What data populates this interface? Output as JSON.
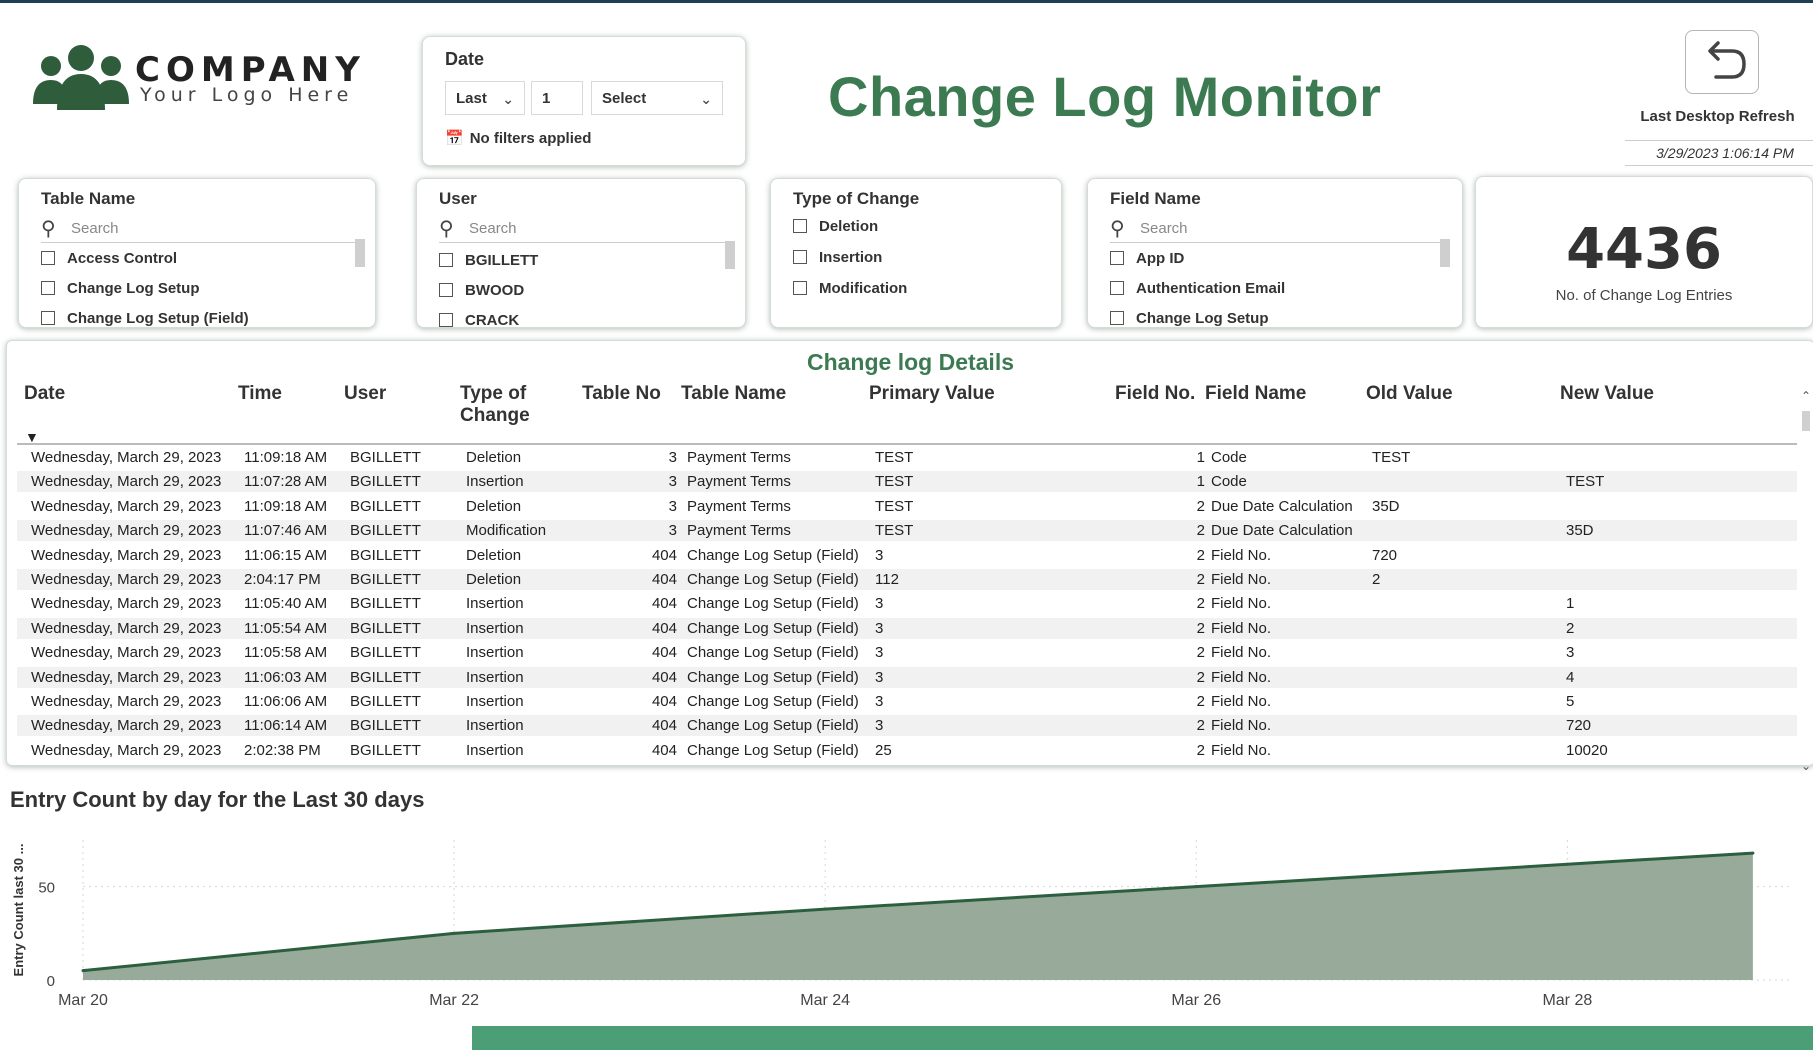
{
  "logo": {
    "company": "COMPANY",
    "tagline": "Your Logo Here"
  },
  "date_filter": {
    "label": "Date",
    "period_option": "Last",
    "period_count": "1",
    "unit_placeholder": "Select",
    "status": "No filters applied"
  },
  "header": {
    "title": "Change Log Monitor"
  },
  "refresh": {
    "label": "Last Desktop Refresh",
    "timestamp": "3/29/2023 1:06:14 PM"
  },
  "slicers": {
    "table_name": {
      "title": "Table Name",
      "search_placeholder": "Search",
      "options": [
        "Access Control",
        "Change Log Setup",
        "Change Log Setup (Field)"
      ]
    },
    "user": {
      "title": "User",
      "search_placeholder": "Search",
      "options": [
        "BGILLETT",
        "BWOOD",
        "CRACK"
      ]
    },
    "type_of_change": {
      "title": "Type of Change",
      "options": [
        "Deletion",
        "Insertion",
        "Modification"
      ]
    },
    "field_name": {
      "title": "Field Name",
      "search_placeholder": "Search",
      "options": [
        "App ID",
        "Authentication Email",
        "Change Log Setup"
      ]
    }
  },
  "kpi": {
    "value": "4436",
    "label": "No. of Change Log Entries"
  },
  "details_table": {
    "title": "Change log Details",
    "columns": {
      "date": "Date",
      "time": "Time",
      "user": "User",
      "type_of_change_1": "Type of",
      "type_of_change_2": "Change",
      "table_no": "Table No",
      "table_name": "Table Name",
      "primary_value": "Primary Value",
      "field_no": "Field No.",
      "field_name": "Field Name",
      "old_value": "Old Value",
      "new_value": "New Value"
    },
    "rows": [
      [
        "Wednesday, March 29, 2023",
        "11:09:18 AM",
        "BGILLETT",
        "Deletion",
        "3",
        "Payment Terms",
        "TEST",
        "1",
        "Code",
        "TEST",
        ""
      ],
      [
        "Wednesday, March 29, 2023",
        "11:07:28 AM",
        "BGILLETT",
        "Insertion",
        "3",
        "Payment Terms",
        "TEST",
        "1",
        "Code",
        "",
        "TEST"
      ],
      [
        "Wednesday, March 29, 2023",
        "11:09:18 AM",
        "BGILLETT",
        "Deletion",
        "3",
        "Payment Terms",
        "TEST",
        "2",
        "Due Date Calculation",
        "35D",
        ""
      ],
      [
        "Wednesday, March 29, 2023",
        "11:07:46 AM",
        "BGILLETT",
        "Modification",
        "3",
        "Payment Terms",
        "TEST",
        "2",
        "Due Date Calculation",
        "",
        "35D"
      ],
      [
        "Wednesday, March 29, 2023",
        "11:06:15 AM",
        "BGILLETT",
        "Deletion",
        "404",
        "Change Log Setup (Field)",
        "3",
        "2",
        "Field No.",
        "720",
        ""
      ],
      [
        "Wednesday, March 29, 2023",
        "2:04:17 PM",
        "BGILLETT",
        "Deletion",
        "404",
        "Change Log Setup (Field)",
        "112",
        "2",
        "Field No.",
        "2",
        ""
      ],
      [
        "Wednesday, March 29, 2023",
        "11:05:40 AM",
        "BGILLETT",
        "Insertion",
        "404",
        "Change Log Setup (Field)",
        "3",
        "2",
        "Field No.",
        "",
        "1"
      ],
      [
        "Wednesday, March 29, 2023",
        "11:05:54 AM",
        "BGILLETT",
        "Insertion",
        "404",
        "Change Log Setup (Field)",
        "3",
        "2",
        "Field No.",
        "",
        "2"
      ],
      [
        "Wednesday, March 29, 2023",
        "11:05:58 AM",
        "BGILLETT",
        "Insertion",
        "404",
        "Change Log Setup (Field)",
        "3",
        "2",
        "Field No.",
        "",
        "3"
      ],
      [
        "Wednesday, March 29, 2023",
        "11:06:03 AM",
        "BGILLETT",
        "Insertion",
        "404",
        "Change Log Setup (Field)",
        "3",
        "2",
        "Field No.",
        "",
        "4"
      ],
      [
        "Wednesday, March 29, 2023",
        "11:06:06 AM",
        "BGILLETT",
        "Insertion",
        "404",
        "Change Log Setup (Field)",
        "3",
        "2",
        "Field No.",
        "",
        "5"
      ],
      [
        "Wednesday, March 29, 2023",
        "11:06:14 AM",
        "BGILLETT",
        "Insertion",
        "404",
        "Change Log Setup (Field)",
        "3",
        "2",
        "Field No.",
        "",
        "720"
      ],
      [
        "Wednesday, March 29, 2023",
        "2:02:38 PM",
        "BGILLETT",
        "Insertion",
        "404",
        "Change Log Setup (Field)",
        "25",
        "2",
        "Field No.",
        "",
        "10020"
      ]
    ]
  },
  "chart_data": {
    "type": "area",
    "title": "Entry Count by day for the Last 30 days",
    "ylabel": "Entry Count last 30 ...",
    "xlabel": "",
    "x": [
      "Mar 20",
      "Mar 22",
      "Mar 24",
      "Mar 26",
      "Mar 28",
      "Mar 29"
    ],
    "x_ticks": [
      "Mar 20",
      "Mar 22",
      "Mar 24",
      "Mar 26",
      "Mar 28"
    ],
    "values": [
      5,
      25,
      38,
      50,
      62,
      68
    ],
    "y_ticks": [
      0,
      50
    ],
    "ylim": [
      0,
      75
    ],
    "grid": true,
    "fill_color": "#98ab9a",
    "line_color": "#2c5f3e"
  },
  "colors": {
    "accent": "#3c7a52",
    "bottom_bar": "#4c9e77",
    "top_border": "#1f3f52"
  }
}
